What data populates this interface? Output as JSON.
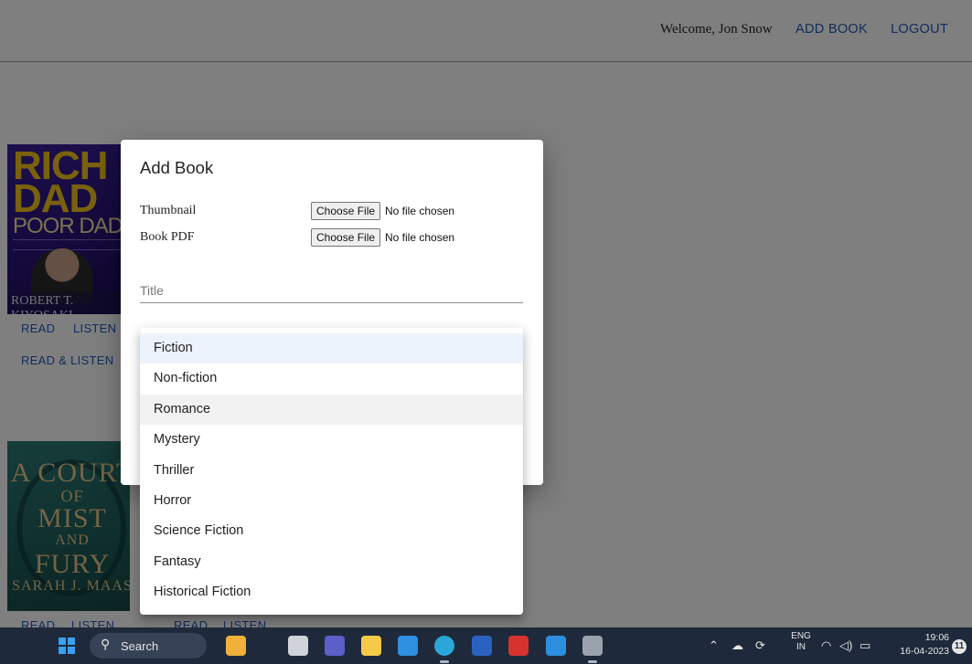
{
  "navbar": {
    "welcome": "Welcome, Jon Snow",
    "add_book": "ADD BOOK",
    "logout": "LOGOUT"
  },
  "books": [
    {
      "cover_title_line1": "RICH",
      "cover_title_line2": "DAD",
      "cover_subtitle": "POOR DAD",
      "cover_author": "ROBERT T. KIYOSAKI",
      "links": [
        "READ",
        "LISTEN",
        "READ & LISTEN"
      ]
    },
    {
      "cover_lines": [
        "A COURT",
        "OF",
        "MIST",
        "AND",
        "FURY"
      ],
      "cover_author": "SARAH J. MAAS",
      "links": [
        "READ",
        "LISTEN"
      ]
    }
  ],
  "extra_links": [
    "READ",
    "LISTEN"
  ],
  "modal": {
    "title": "Add Book",
    "thumbnail_label": "Thumbnail",
    "pdf_label": "Book PDF",
    "choose_file": "Choose File",
    "no_file": "No file chosen",
    "title_placeholder": "Title"
  },
  "dropdown": {
    "options": [
      "Fiction",
      "Non-fiction",
      "Romance",
      "Mystery",
      "Thriller",
      "Horror",
      "Science Fiction",
      "Fantasy",
      "Historical Fiction"
    ],
    "selected": "Fiction",
    "hovered": "Romance"
  },
  "taskbar": {
    "search_label": "Search",
    "lang_top": "ENG",
    "lang_bottom": "IN",
    "time": "19:06",
    "date": "16-04-2023",
    "notification_count": "11",
    "apps": [
      "widgets-icon",
      "task-view-icon",
      "meet-icon",
      "file-explorer-icon",
      "mail-icon",
      "edge-icon",
      "word-icon",
      "wps-icon",
      "vscode-icon",
      "terminal-icon"
    ],
    "app_colors": [
      "#f0b03a",
      "#d0d4da",
      "#5b5fc7",
      "#f7c948",
      "#2f8fe0",
      "#2aa7d8",
      "#2b62c0",
      "#d6322e",
      "#2d8fe0",
      "#9aa3ad"
    ]
  }
}
